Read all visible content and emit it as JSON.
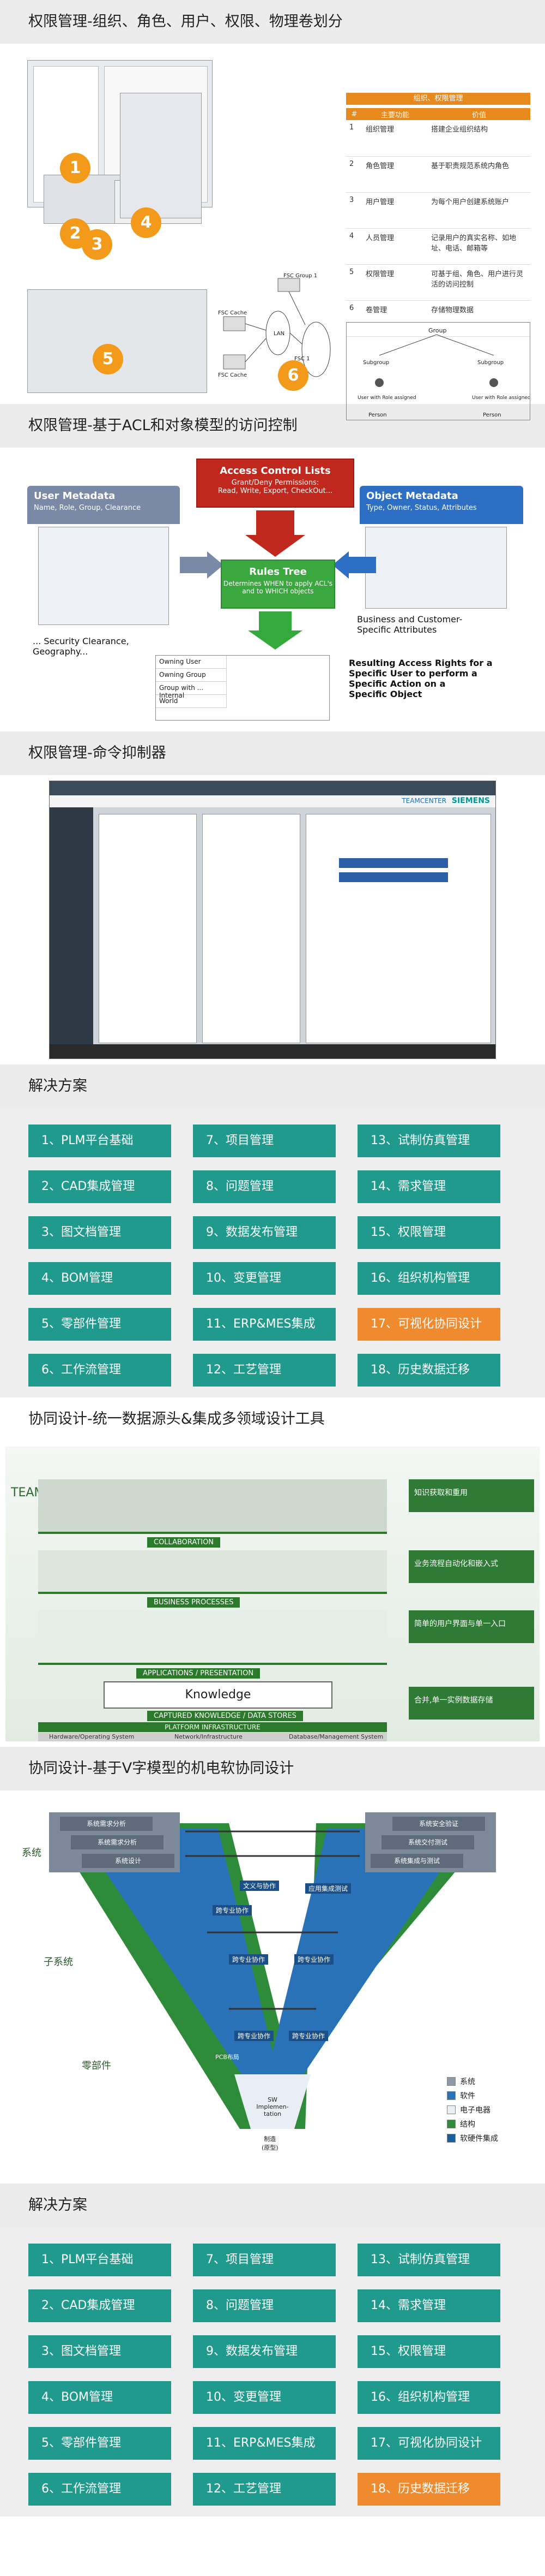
{
  "sections": {
    "s1_title": "权限管理-组织、角色、用户、权限、物理卷划分",
    "s2_title": "权限管理-基于ACL和对象模型的访问控制",
    "s3_title": "权限管理-命令抑制器",
    "s4_title": "解决方案",
    "s5_title": "协同设计-统一数据源头&集成多领域设计工具",
    "s6_title": "协同设计-基于V字模型的机电软协同设计",
    "s7_title": "解决方案"
  },
  "s1": {
    "badges": [
      "1",
      "2",
      "3",
      "4",
      "5",
      "6"
    ],
    "table_header_top": "组织、权限管理",
    "table_cols": [
      "#",
      "主要功能",
      "价值"
    ],
    "table_rows": [
      {
        "n": "1",
        "f": "组织管理",
        "v": "搭建企业组织结构"
      },
      {
        "n": "2",
        "f": "角色管理",
        "v": "基于职责规范系统内角色"
      },
      {
        "n": "3",
        "f": "用户管理",
        "v": "为每个用户创建系统账户"
      },
      {
        "n": "4",
        "f": "人员管理",
        "v": "记录用户的真实名称、如地址、电话、邮箱等"
      },
      {
        "n": "5",
        "f": "权限管理",
        "v": "可基于组、角色、用户进行灵活的访问控制"
      },
      {
        "n": "6",
        "f": "卷管理",
        "v": "存储物理数据"
      }
    ],
    "fsc_group": "FSC Group 1",
    "fsc_cache": "FSC Cache",
    "fsc_master": "FSC 1",
    "lan": "LAN",
    "group_label": "Group",
    "subgroup_label": "Subgroup",
    "user_role_label": "User\nwith Role assigned",
    "person_label": "Person"
  },
  "s2": {
    "acl_title": "Access Control Lists",
    "acl_sub": "Grant/Deny Permissions:\nRead, Write, Export, CheckOut...",
    "user_meta_title": "User Metadata",
    "user_meta_sub": "Name, Role, Group, Clearance",
    "obj_meta_title": "Object Metadata",
    "obj_meta_sub": "Type, Owner, Status, Attributes",
    "rules_title": "Rules Tree",
    "rules_sub": "Determines WHEN to apply ACL's\nand to WHICH objects",
    "security": "... Security Clearance,\nGeography...",
    "business": "Business and Customer-\nSpecific Attributes",
    "resulting": "Resulting Access Rights for a\nSpecific User to perform a\nSpecific Action on a\nSpecific Object",
    "rows": [
      "Owning User",
      "Owning Group",
      "Group with ... Internal",
      "World"
    ]
  },
  "s3": {
    "brand": "SIEMENS",
    "teamcenter": "TEAMCENTER"
  },
  "solutions1": [
    "1、PLM平台基础",
    "7、项目管理",
    "13、试制仿真管理",
    "2、CAD集成管理",
    "8、问题管理",
    "14、需求管理",
    "3、图文档管理",
    "9、数据发布管理",
    "15、权限管理",
    "4、BOM管理",
    "10、变更管理",
    "16、组织机构管理",
    "5、零部件管理",
    "11、ERP&MES集成",
    "17、可视化协同设计",
    "6、工作流管理",
    "12、工艺管理",
    "18、历史数据迁移"
  ],
  "solutions1_highlight": 14,
  "s5": {
    "collab": "COLLABORATION",
    "biz": "BUSINESS PROCESSES",
    "app": "APPLICATIONS / PRESENTATION",
    "knowledge": "Knowledge",
    "captured": "CAPTURED KNOWLEDGE / DATA STORES",
    "platform": "PLATFORM INFRASTRUCTURE",
    "hw": "Hardware/Operating System",
    "net": "Network/Infrastructure",
    "db": "Database/Management System",
    "teamcenter_v": "TEAMCENTER",
    "right_labels": [
      "知识获取和重用",
      "业务流程自动化和嵌入式",
      "简单的用户界面与单一入口",
      "合并,单一实例数据存储"
    ]
  },
  "s6": {
    "left_labels": [
      "系统",
      "子系统",
      "零部件"
    ],
    "left_boxes": [
      "系统需求分析",
      "系统需求分析",
      "系统设计"
    ],
    "right_boxes": [
      "系统安全验证",
      "系统交付测试",
      "系统集成与测试"
    ],
    "inner": [
      "文义与协作",
      "跨专业协作",
      "应用集成测试",
      "跨专业协作",
      "跨专业协作",
      "跨专业协作",
      "跨专业协作"
    ],
    "center": "SW Implemen-\ntation",
    "pcb": "PCB布局",
    "mfg": "制造\n(原型)",
    "legend": [
      "系统",
      "软件",
      "电子电器",
      "结构",
      "软硬件集成"
    ],
    "legend_colors": [
      "#8e9aa8",
      "#2a72b8",
      "#e8eef4",
      "#2e8b3a",
      "#1a5c9e"
    ]
  },
  "solutions2": [
    "1、PLM平台基础",
    "7、项目管理",
    "13、试制仿真管理",
    "2、CAD集成管理",
    "8、问题管理",
    "14、需求管理",
    "3、图文档管理",
    "9、数据发布管理",
    "15、权限管理",
    "4、BOM管理",
    "10、变更管理",
    "16、组织机构管理",
    "5、零部件管理",
    "11、ERP&MES集成",
    "17、可视化协同设计",
    "6、工作流管理",
    "12、工艺管理",
    "18、历史数据迁移"
  ],
  "solutions2_highlight": 17
}
